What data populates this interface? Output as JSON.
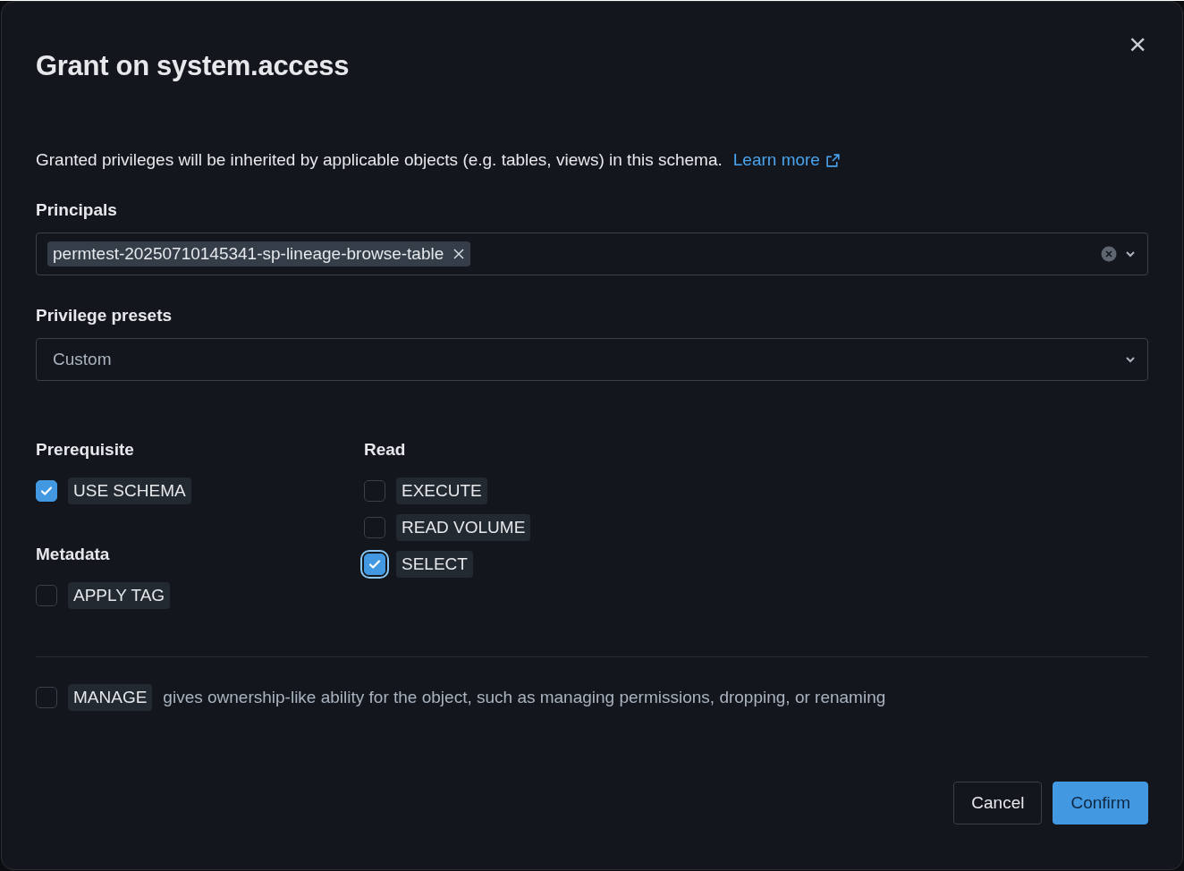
{
  "dialog": {
    "title": "Grant on system.access",
    "close": "×"
  },
  "description": "Granted privileges will be inherited by applicable objects (e.g. tables, views) in this schema.",
  "learn_more": "Learn more",
  "principals": {
    "label": "Principals",
    "chips": [
      "permtest-20250710145341-sp-lineage-browse-table"
    ]
  },
  "presets": {
    "label": "Privilege presets",
    "value": "Custom"
  },
  "columns": [
    {
      "groups": [
        {
          "title": "Prerequisite",
          "items": [
            {
              "label": "USE SCHEMA",
              "checked": true,
              "focused": false
            }
          ]
        },
        {
          "title": "Metadata",
          "items": [
            {
              "label": "APPLY TAG",
              "checked": false,
              "focused": false
            }
          ]
        }
      ]
    },
    {
      "groups": [
        {
          "title": "Read",
          "items": [
            {
              "label": "EXECUTE",
              "checked": false,
              "focused": false
            },
            {
              "label": "READ VOLUME",
              "checked": false,
              "focused": false
            },
            {
              "label": "SELECT",
              "checked": true,
              "focused": true
            }
          ]
        }
      ]
    }
  ],
  "manage": {
    "label": "MANAGE",
    "checked": false,
    "description": "gives ownership-like ability for the object, such as managing permissions, dropping, or renaming"
  },
  "buttons": [
    {
      "label": "Cancel",
      "kind": "secondary"
    },
    {
      "label": "Confirm",
      "kind": "primary"
    }
  ]
}
